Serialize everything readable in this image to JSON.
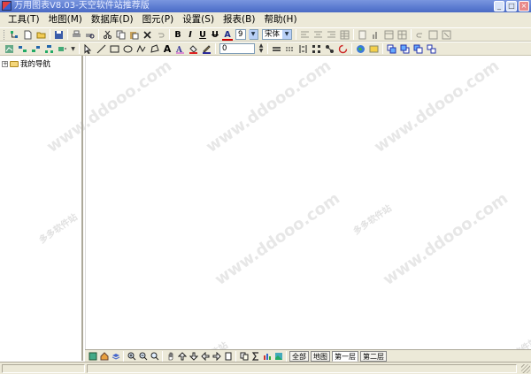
{
  "window": {
    "title": "万用图表V8.03-天空软件站推荐版",
    "buttons": {
      "minimize": "_",
      "maximize": "□",
      "close": "×"
    }
  },
  "menu": [
    "工具(T)",
    "地图(M)",
    "数据库(D)",
    "图元(P)",
    "设置(S)",
    "报表(B)",
    "帮助(H)"
  ],
  "toolbar_format": {
    "bold": "B",
    "italic": "I",
    "underline": "U",
    "strikeout": "U",
    "font_color": "A",
    "font_size": "9",
    "font_name": "宋体"
  },
  "toolbar_draw": {
    "text_tool": "A",
    "line_width": "0"
  },
  "nav_tree": {
    "root_label": "我的导航",
    "expander": "+"
  },
  "bottom_tabs": [
    "全部",
    "地图",
    "第一层",
    "第二层"
  ],
  "bottom_active_tab": "第一层",
  "watermark": {
    "text": "www.ddooo.com",
    "site": "多多软件站"
  }
}
